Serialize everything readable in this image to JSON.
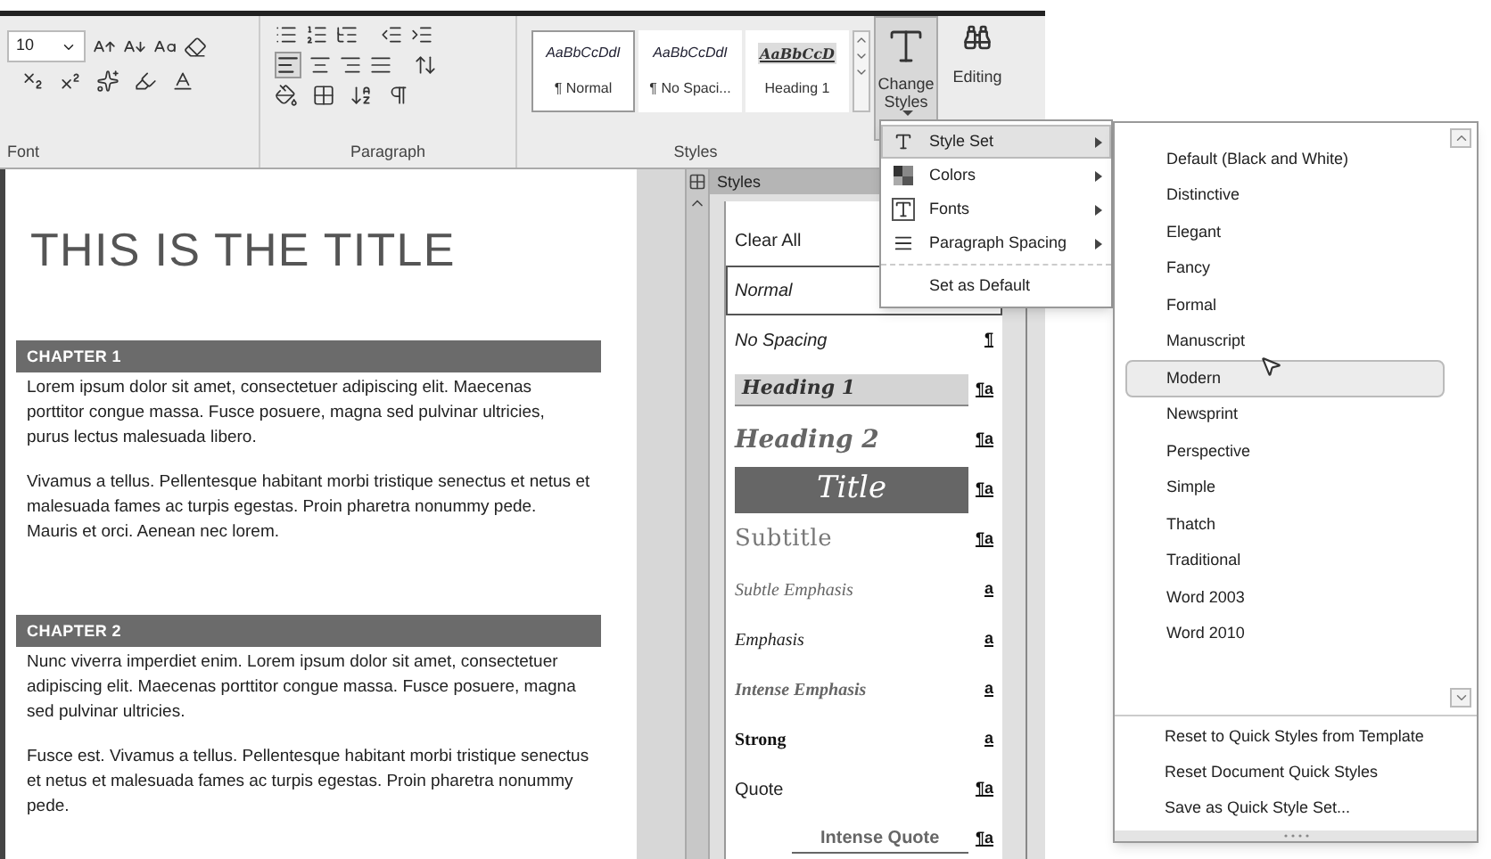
{
  "ribbon": {
    "font_size": "10",
    "group_labels": [
      "Font",
      "Paragraph",
      "Styles"
    ],
    "quick_styles": [
      {
        "preview": "AaBbCcDdI",
        "name": "¶ Normal",
        "kind": "normal",
        "selected": true
      },
      {
        "preview": "AaBbCcDdI",
        "name": "¶ No Spaci...",
        "kind": "nospacing",
        "selected": false
      },
      {
        "preview": "AaBbCcD",
        "name": "Heading 1",
        "kind": "heading",
        "selected": false
      }
    ],
    "change_styles": "Change Styles",
    "editing": "Editing"
  },
  "document": {
    "title": "THIS IS THE TITLE",
    "sections": [
      {
        "heading": "CHAPTER 1",
        "paragraphs": [
          "Lorem ipsum dolor sit amet, consectetuer adipiscing elit. Maecenas porttitor congue massa.  Fusce posuere, magna sed pulvinar ultricies, purus lectus malesuada libero.",
          "Vivamus a tellus. Pellentesque habitant morbi tristique senectus et netus et malesuada fames ac turpis egestas. Proin pharetra nonummy pede. Mauris et orci. Aenean nec lorem."
        ]
      },
      {
        "heading": "CHAPTER 2",
        "paragraphs": [
          "Nunc viverra imperdiet enim. Lorem ipsum dolor sit amet, consectetuer adipiscing elit. Maecenas porttitor congue massa. Fusce posuere, magna sed pulvinar ultricies.",
          "Fusce est. Vivamus a tellus. Pellentesque habitant morbi tristique senectus et netus et malesuada fames ac turpis egestas. Proin pharetra nonummy pede."
        ]
      }
    ]
  },
  "styles_pane": {
    "title": "Styles",
    "items": [
      {
        "name": "Clear All",
        "kind": "clear",
        "selected": false
      },
      {
        "name": "Normal",
        "kind": "normal",
        "selected": true
      },
      {
        "name": "No Spacing",
        "kind": "nospacing",
        "marker": "¶",
        "selected": false
      },
      {
        "name": "Heading 1",
        "kind": "heading1",
        "marker": "¶a",
        "selected": false
      },
      {
        "name": "Heading 2",
        "kind": "heading2",
        "marker": "¶a",
        "selected": false
      },
      {
        "name": "Title",
        "kind": "title",
        "marker": "¶a",
        "selected": false
      },
      {
        "name": "Subtitle",
        "kind": "subtitle",
        "marker": "¶a",
        "selected": false
      },
      {
        "name": "Subtle Emphasis",
        "kind": "subtle",
        "marker": "a",
        "selected": false
      },
      {
        "name": "Emphasis",
        "kind": "emphasis",
        "marker": "a",
        "selected": false
      },
      {
        "name": "Intense Emphasis",
        "kind": "intense",
        "marker": "a",
        "selected": false
      },
      {
        "name": "Strong",
        "kind": "strong",
        "marker": "a",
        "selected": false
      },
      {
        "name": "Quote",
        "kind": "quote",
        "marker": "¶a",
        "selected": false
      },
      {
        "name": "Intense Quote",
        "kind": "intensequote",
        "marker": "¶a",
        "selected": false
      }
    ]
  },
  "change_styles_menu": {
    "items": [
      {
        "label": "Style Set",
        "kind": "submenu",
        "selected": true
      },
      {
        "label": "Colors",
        "kind": "submenu",
        "selected": false
      },
      {
        "label": "Fonts",
        "kind": "submenu",
        "selected": false
      },
      {
        "label": "Paragraph Spacing",
        "kind": "submenu",
        "selected": false
      },
      {
        "label": "Set as Default",
        "kind": "command",
        "selected": false
      }
    ]
  },
  "style_set_menu": {
    "items": [
      {
        "label": "Default (Black and White)",
        "selected": false
      },
      {
        "label": "Distinctive",
        "selected": false
      },
      {
        "label": "Elegant",
        "selected": false
      },
      {
        "label": "Fancy",
        "selected": false
      },
      {
        "label": "Formal",
        "selected": false
      },
      {
        "label": "Manuscript",
        "selected": false
      },
      {
        "label": "Modern",
        "selected": true
      },
      {
        "label": "Newsprint",
        "selected": false
      },
      {
        "label": "Perspective",
        "selected": false
      },
      {
        "label": "Simple",
        "selected": false
      },
      {
        "label": "Thatch",
        "selected": false
      },
      {
        "label": "Traditional",
        "selected": false
      },
      {
        "label": "Word 2003",
        "selected": false
      },
      {
        "label": "Word 2010",
        "selected": false
      }
    ],
    "commands": [
      "Reset to Quick Styles from Template",
      "Reset Document Quick Styles",
      "Save as Quick Style Set..."
    ]
  }
}
